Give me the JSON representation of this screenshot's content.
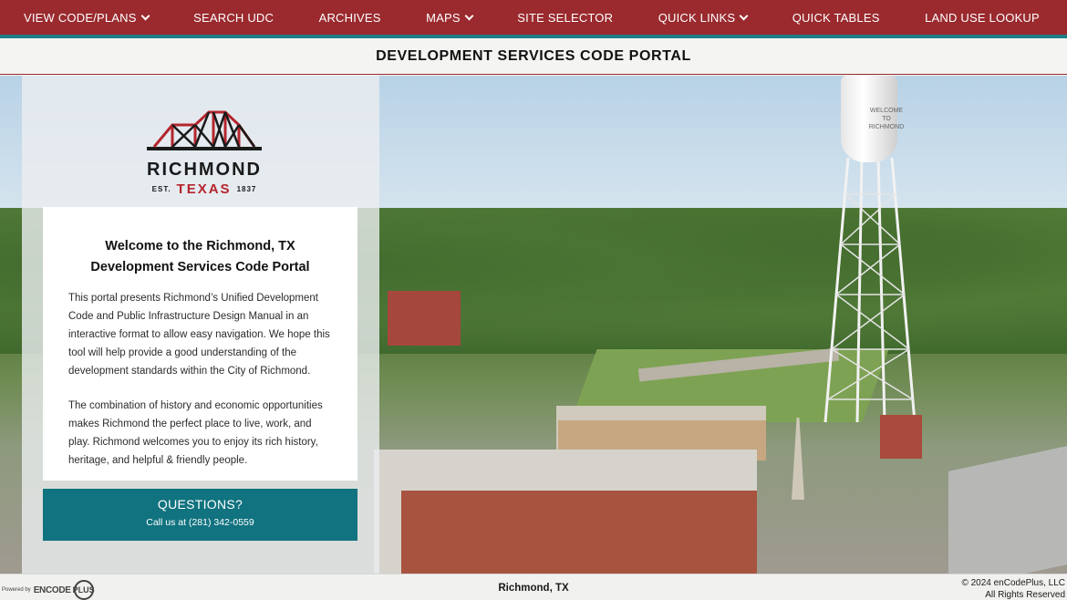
{
  "nav": {
    "items": [
      {
        "label": "VIEW CODE/PLANS",
        "dropdown": true
      },
      {
        "label": "SEARCH UDC",
        "dropdown": false
      },
      {
        "label": "ARCHIVES",
        "dropdown": false
      },
      {
        "label": "MAPS",
        "dropdown": true
      },
      {
        "label": "SITE SELECTOR",
        "dropdown": false
      },
      {
        "label": "QUICK LINKS",
        "dropdown": true
      },
      {
        "label": "QUICK TABLES",
        "dropdown": false
      },
      {
        "label": "LAND USE LOOKUP",
        "dropdown": false
      }
    ]
  },
  "header": {
    "title": "DEVELOPMENT SERVICES CODE PORTAL"
  },
  "logo": {
    "name": "RICHMOND",
    "est": "EST.",
    "state": "TEXAS",
    "year": "1837"
  },
  "hero": {
    "tower_text": "WELCOME TO RICHMOND"
  },
  "welcome": {
    "heading_line1": "Welcome to the Richmond, TX",
    "heading_line2": "Development Services Code Portal",
    "paragraph1": "This portal presents Richmond’s Unified Development Code and Public Infrastructure Design Manual in an interactive format to allow easy navigation. We hope this tool will help provide a good understanding of the development standards within the City of Richmond.",
    "paragraph2": "The combination of history and economic opportunities makes Richmond the perfect place to live, work, and play. Richmond welcomes you to enjoy its rich history, heritage, and helpful & friendly people."
  },
  "questions": {
    "title": "QUESTIONS?",
    "call": "Call us at (281) 342-0559"
  },
  "footer": {
    "powered_by": "Powered by",
    "brand": "ENCODE",
    "brand_circle": "PLUS",
    "location": "Richmond, TX",
    "copyright": "© 2024 enCodePlus, LLC",
    "rights": "All Rights Reserved"
  },
  "colors": {
    "nav_bg": "#9a2a2e",
    "accent": "#1f7d86",
    "button_bg": "#11737f",
    "logo_red": "#b3262c"
  }
}
